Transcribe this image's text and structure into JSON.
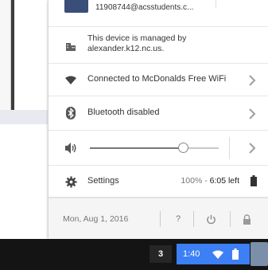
{
  "tray": {
    "account_email": "11908744@acsstudents.c...",
    "managed_text_line1": "This device is managed by",
    "managed_text_line2": "alexander.k12.nc.us.",
    "wifi_label": "Connected to McDonalds Free WiFi",
    "bluetooth_label": "Bluetooth disabled",
    "volume_level": 0.72,
    "settings_label": "Settings",
    "battery_percent": "100%",
    "battery_separator": " - ",
    "battery_time": "6:05 left"
  },
  "footer": {
    "date": "Mon, Aug 1, 2016",
    "help_label": "?"
  },
  "shelf": {
    "notification_count": "3",
    "clock": "1:40"
  },
  "colors": {
    "shelf_accent": "#3d7ff5",
    "shelf_bg": "#141414",
    "icon_grey": "#616161"
  },
  "icons": [
    "building-icon",
    "wifi-icon",
    "bluetooth-icon",
    "volume-icon",
    "gear-icon",
    "power-icon",
    "lock-icon",
    "battery-icon",
    "chevron-right-icon"
  ]
}
